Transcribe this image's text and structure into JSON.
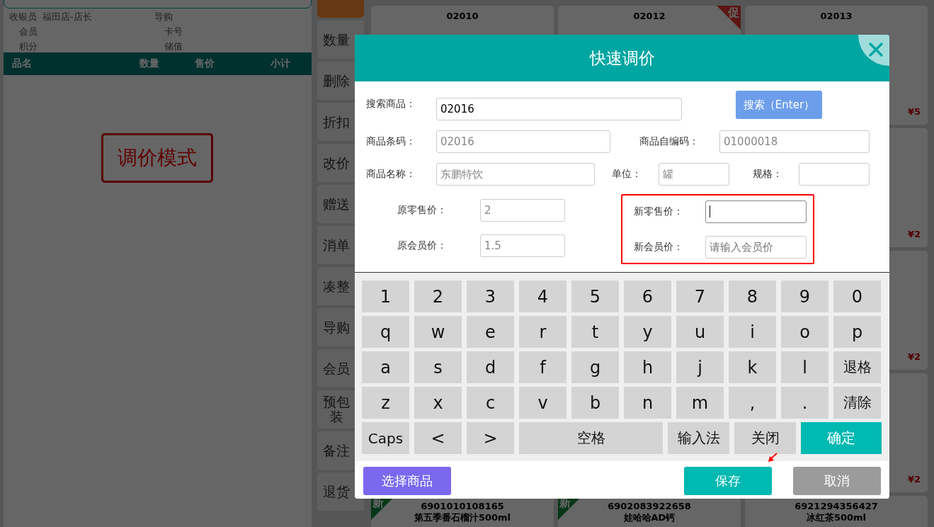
{
  "left_panel": {
    "info": [
      {
        "label": "收银员",
        "value": "福田店-店长",
        "label2": "导购"
      },
      {
        "label": "会员",
        "label2": "卡号"
      },
      {
        "label": "积分",
        "label2": "储值"
      }
    ],
    "table": {
      "columns": [
        "品名",
        "数量",
        "售价",
        "小计"
      ]
    },
    "mode_badge": "调价模式"
  },
  "sidebar": {
    "items": [
      "数量",
      "删除",
      "折扣",
      "改价",
      "赠送",
      "消单",
      "凑整",
      "导购",
      "会员",
      "预包装",
      "备注",
      "退货"
    ]
  },
  "product_rows": [
    {
      "cards": [
        {
          "code": "02010"
        },
        {
          "code": "02012",
          "badge": {
            "text": "促",
            "kind": "promo"
          }
        },
        {
          "code": "02013",
          "price": "¥5"
        }
      ]
    },
    {
      "cards": [
        {
          "price": "¥2"
        }
      ]
    },
    {
      "cards": [
        {
          "price": "¥2"
        }
      ]
    },
    {
      "cards": [
        {
          "price": "¥2"
        }
      ]
    },
    {
      "cards": [
        {
          "code": "6901010108165",
          "name": "第五季番石榴汁500ml",
          "badge": {
            "text": "新",
            "kind": "new"
          }
        },
        {
          "code": "6902083922658",
          "name": "娃哈哈AD钙",
          "badge": {
            "text": "新",
            "kind": "new"
          }
        },
        {
          "code": "6921294356427",
          "name": "冰红茶500ml"
        }
      ]
    }
  ],
  "dialog": {
    "title": "快速调价",
    "search": {
      "label": "搜索商品：",
      "value": "02016",
      "button": "搜索（Enter）"
    },
    "fields": [
      {
        "label": "商品条码：",
        "value": "02016",
        "disabled": true
      },
      {
        "label": "商品自编码：",
        "value": "01000018",
        "disabled": true
      },
      {
        "label": "商品名称：",
        "value": "东鹏特饮",
        "disabled": true
      },
      {
        "label": "单位：",
        "value": "罐",
        "disabled": true
      },
      {
        "label": "规格："
      }
    ],
    "old_prices": [
      {
        "label": "原零售价：",
        "value": "2"
      },
      {
        "label": "原会员价：",
        "value": "1.5"
      }
    ],
    "new_prices": {
      "highlighted": true,
      "fields": [
        {
          "label": "新零售价：",
          "focused": true
        },
        {
          "label": "新会员价：",
          "placeholder": "请输入会员价",
          "focused": false
        }
      ]
    },
    "keyboard": [
      [
        {
          "label": "1",
          "kind": "key"
        },
        {
          "label": "2",
          "kind": "key"
        },
        {
          "label": "3",
          "kind": "key"
        },
        {
          "label": "4",
          "kind": "key"
        },
        {
          "label": "5",
          "kind": "key"
        },
        {
          "label": "6",
          "kind": "key"
        },
        {
          "label": "7",
          "kind": "key"
        },
        {
          "label": "8",
          "kind": "key"
        },
        {
          "label": "9",
          "kind": "key"
        },
        {
          "label": "0",
          "kind": "key"
        }
      ],
      [
        {
          "label": "q",
          "kind": "key"
        },
        {
          "label": "w",
          "kind": "key"
        },
        {
          "label": "e",
          "kind": "key"
        },
        {
          "label": "r",
          "kind": "key"
        },
        {
          "label": "t",
          "kind": "key"
        },
        {
          "label": "y",
          "kind": "key"
        },
        {
          "label": "u",
          "kind": "key"
        },
        {
          "label": "i",
          "kind": "key"
        },
        {
          "label": "o",
          "kind": "key"
        },
        {
          "label": "p",
          "kind": "key"
        }
      ],
      [
        {
          "label": "a",
          "kind": "key"
        },
        {
          "label": "s",
          "kind": "key"
        },
        {
          "label": "d",
          "kind": "key"
        },
        {
          "label": "f",
          "kind": "key"
        },
        {
          "label": "g",
          "kind": "key"
        },
        {
          "label": "h",
          "kind": "key"
        },
        {
          "label": "j",
          "kind": "key"
        },
        {
          "label": "k",
          "kind": "key"
        },
        {
          "label": "l",
          "kind": "key"
        },
        {
          "label": "退格",
          "kind": "key"
        }
      ],
      [
        {
          "label": "z",
          "kind": "key"
        },
        {
          "label": "x",
          "kind": "key"
        },
        {
          "label": "c",
          "kind": "key"
        },
        {
          "label": "v",
          "kind": "key"
        },
        {
          "label": "b",
          "kind": "key"
        },
        {
          "label": "n",
          "kind": "key"
        },
        {
          "label": "m",
          "kind": "key"
        },
        {
          "label": ",",
          "kind": "key"
        },
        {
          "label": ".",
          "kind": "key"
        },
        {
          "label": "清除",
          "kind": "key"
        }
      ],
      [
        {
          "label": "Caps",
          "kind": "key"
        },
        {
          "label": "<",
          "kind": "key"
        },
        {
          "label": ">",
          "kind": "key"
        },
        {
          "label": "空格",
          "kind": "space"
        },
        {
          "label": "输入法",
          "kind": "action"
        },
        {
          "label": "关闭",
          "kind": "action"
        },
        {
          "label": "确定",
          "kind": "confirm"
        }
      ]
    ],
    "footer": {
      "select": "选择商品",
      "save": "保存",
      "cancel": "取消"
    }
  }
}
